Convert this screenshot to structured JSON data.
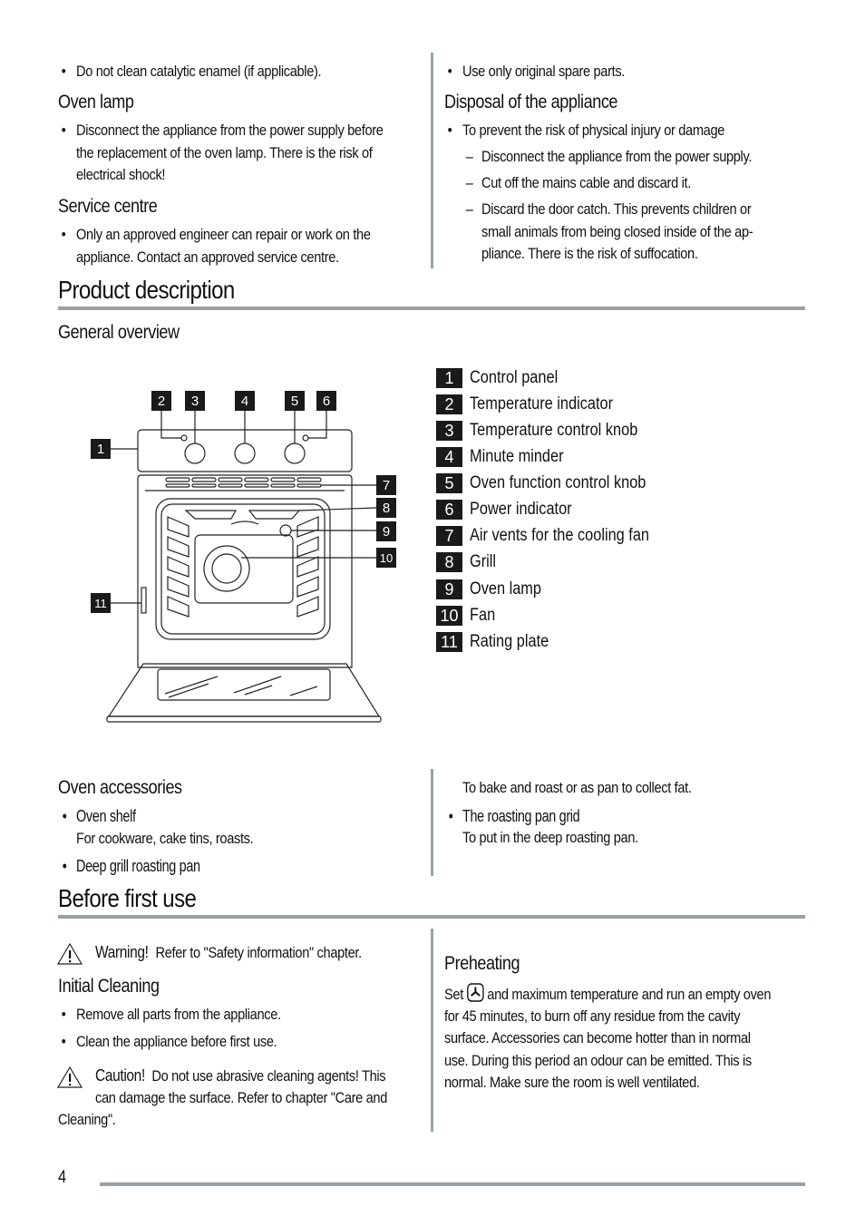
{
  "top_left": {
    "bullet_1": "Do not clean catalytic enamel (if applicable).",
    "oven_lamp": {
      "heading": "Oven lamp",
      "lines": [
        "Disconnect the appliance from the power supply before",
        "the replacement of the oven lamp. There is the risk of",
        "electrical shock!"
      ]
    },
    "service_centre": {
      "heading": "Service centre",
      "lines": [
        "Only an approved engineer can repair or work on the",
        "appliance. Contact an approved service centre."
      ]
    }
  },
  "top_right": {
    "bullet_1": "Use only original spare parts.",
    "disposal": {
      "heading": "Disposal of the appliance",
      "bullet": "To prevent the risk of physical injury or damage",
      "dash_1": "Disconnect the appliance from the power supply.",
      "dash_2": "Cut off the mains cable and discard it.",
      "dash_3_lines": [
        "Discard the door catch. This prevents children or",
        "small animals from being closed inside of the ap-",
        "pliance. There is the risk of suffocation."
      ]
    }
  },
  "product_description": {
    "title": "Product description",
    "general_overview": "General overview",
    "callouts": [
      "1",
      "2",
      "3",
      "4",
      "5",
      "6",
      "7",
      "8",
      "9",
      "10",
      "11"
    ],
    "legend": [
      {
        "num": "1",
        "label": "Control panel"
      },
      {
        "num": "2",
        "label": "Temperature indicator"
      },
      {
        "num": "3",
        "label": "Temperature control knob"
      },
      {
        "num": "4",
        "label": "Minute minder"
      },
      {
        "num": "5",
        "label": "Oven function control knob"
      },
      {
        "num": "6",
        "label": "Power indicator"
      },
      {
        "num": "7",
        "label": "Air vents for the cooling fan"
      },
      {
        "num": "8",
        "label": "Grill"
      },
      {
        "num": "9",
        "label": "Oven lamp"
      },
      {
        "num": "10",
        "label": "Fan"
      },
      {
        "num": "11",
        "label": "Rating plate"
      }
    ]
  },
  "oven_accessories": {
    "heading": "Oven accessories",
    "item_1_title": "Oven shelf",
    "item_1_desc": "For cookware, cake tins, roasts.",
    "item_2_title": "Deep grill roasting pan",
    "item_2_desc": "To bake and roast or as pan to collect fat.",
    "item_3_title": "The roasting pan grid",
    "item_3_desc": "To put in the deep roasting pan."
  },
  "before_first_use": {
    "title": "Before first use",
    "warning_label": "Warning!",
    "warning_text": "Refer to \"Safety information\" chapter.",
    "initial_cleaning": {
      "heading": "Initial Cleaning",
      "bullets": [
        "Remove all parts from the appliance.",
        "Clean the appliance before first use."
      ]
    },
    "caution_label": "Caution!",
    "caution_line_1": "Do not use abrasive cleaning agents! This",
    "caution_line_2": "can damage the surface. Refer to chapter \"Care and",
    "caution_line_3": "Cleaning\".",
    "preheating": {
      "heading": "Preheating",
      "set_word": "Set",
      "icon": "fan-function-icon",
      "line_1_rest": "and maximum temperature and run an empty oven",
      "lines": [
        "for 45 minutes, to burn off any residue from the cavity",
        "surface. Accessories can become hotter than in normal",
        "use. During this period an odour can be emitted. This is",
        "normal. Make sure the room is well ventilated."
      ]
    }
  },
  "footer": {
    "page_number": "4"
  },
  "colors": {
    "rule": "#9aa0a4",
    "callout_bg": "#1a1a1a"
  }
}
